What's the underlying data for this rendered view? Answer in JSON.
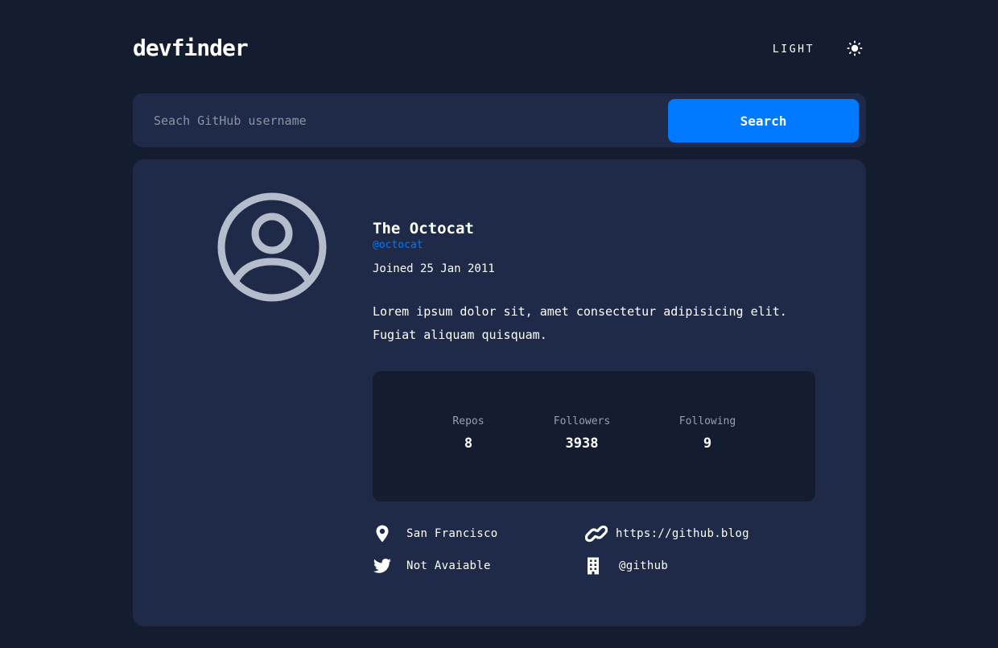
{
  "header": {
    "logo": "devfinder",
    "theme_label": "LIGHT",
    "theme_icon": "sun-icon"
  },
  "search": {
    "placeholder": "Seach GitHub username",
    "value": "",
    "button_label": "Search"
  },
  "profile": {
    "avatar_icon": "user-circle-icon",
    "name": "The Octocat",
    "handle": "@octocat",
    "joined": "Joined 25 Jan 2011",
    "bio": "Lorem ipsum dolor sit, amet consectetur adipisicing elit. Fugiat aliquam quisquam.",
    "stats": [
      {
        "label": "Repos",
        "value": "8"
      },
      {
        "label": "Followers",
        "value": "3938"
      },
      {
        "label": "Following",
        "value": "9"
      }
    ],
    "links": {
      "location": {
        "icon": "location-pin-icon",
        "text": "San Francisco"
      },
      "twitter": {
        "icon": "twitter-icon",
        "text": "Not Avaiable"
      },
      "blog": {
        "icon": "link-icon",
        "text": "https://github.blog"
      },
      "company": {
        "icon": "building-icon",
        "text": "@github"
      }
    }
  },
  "colors": {
    "background": "#141d2f",
    "card": "#1e2a47",
    "accent": "#0079ff",
    "muted": "#97a0b3",
    "avatar": "#b5bccc"
  }
}
